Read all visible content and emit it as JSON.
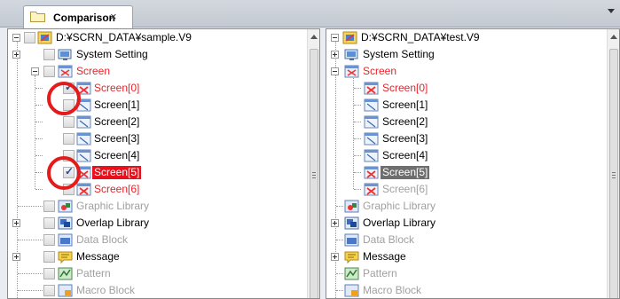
{
  "tab": {
    "label": "Comparison",
    "close": "×"
  },
  "left_tree": {
    "root": "D:¥SCRN_DATA¥sample.V9",
    "system_setting": "System Setting",
    "screen": "Screen",
    "screens": [
      "Screen[0]",
      "Screen[1]",
      "Screen[2]",
      "Screen[3]",
      "Screen[4]",
      "Screen[5]",
      "Screen[6]"
    ],
    "graphic_library": "Graphic Library",
    "overlap_library": "Overlap Library",
    "data_block": "Data Block",
    "message": "Message",
    "pattern": "Pattern",
    "macro_block": "Macro Block"
  },
  "right_tree": {
    "root": "D:¥SCRN_DATA¥test.V9",
    "system_setting": "System Setting",
    "screen": "Screen",
    "screens": [
      "Screen[0]",
      "Screen[1]",
      "Screen[2]",
      "Screen[3]",
      "Screen[4]",
      "Screen[5]",
      "Screen[6]"
    ],
    "graphic_library": "Graphic Library",
    "overlap_library": "Overlap Library",
    "data_block": "Data Block",
    "message": "Message",
    "pattern": "Pattern",
    "macro_block": "Macro Block"
  },
  "colors": {
    "diff_red": "#e8232a",
    "selected_red": "#e8101a",
    "selected_gray": "#6e6e6e",
    "annotation_circle": "#e51b1b"
  }
}
